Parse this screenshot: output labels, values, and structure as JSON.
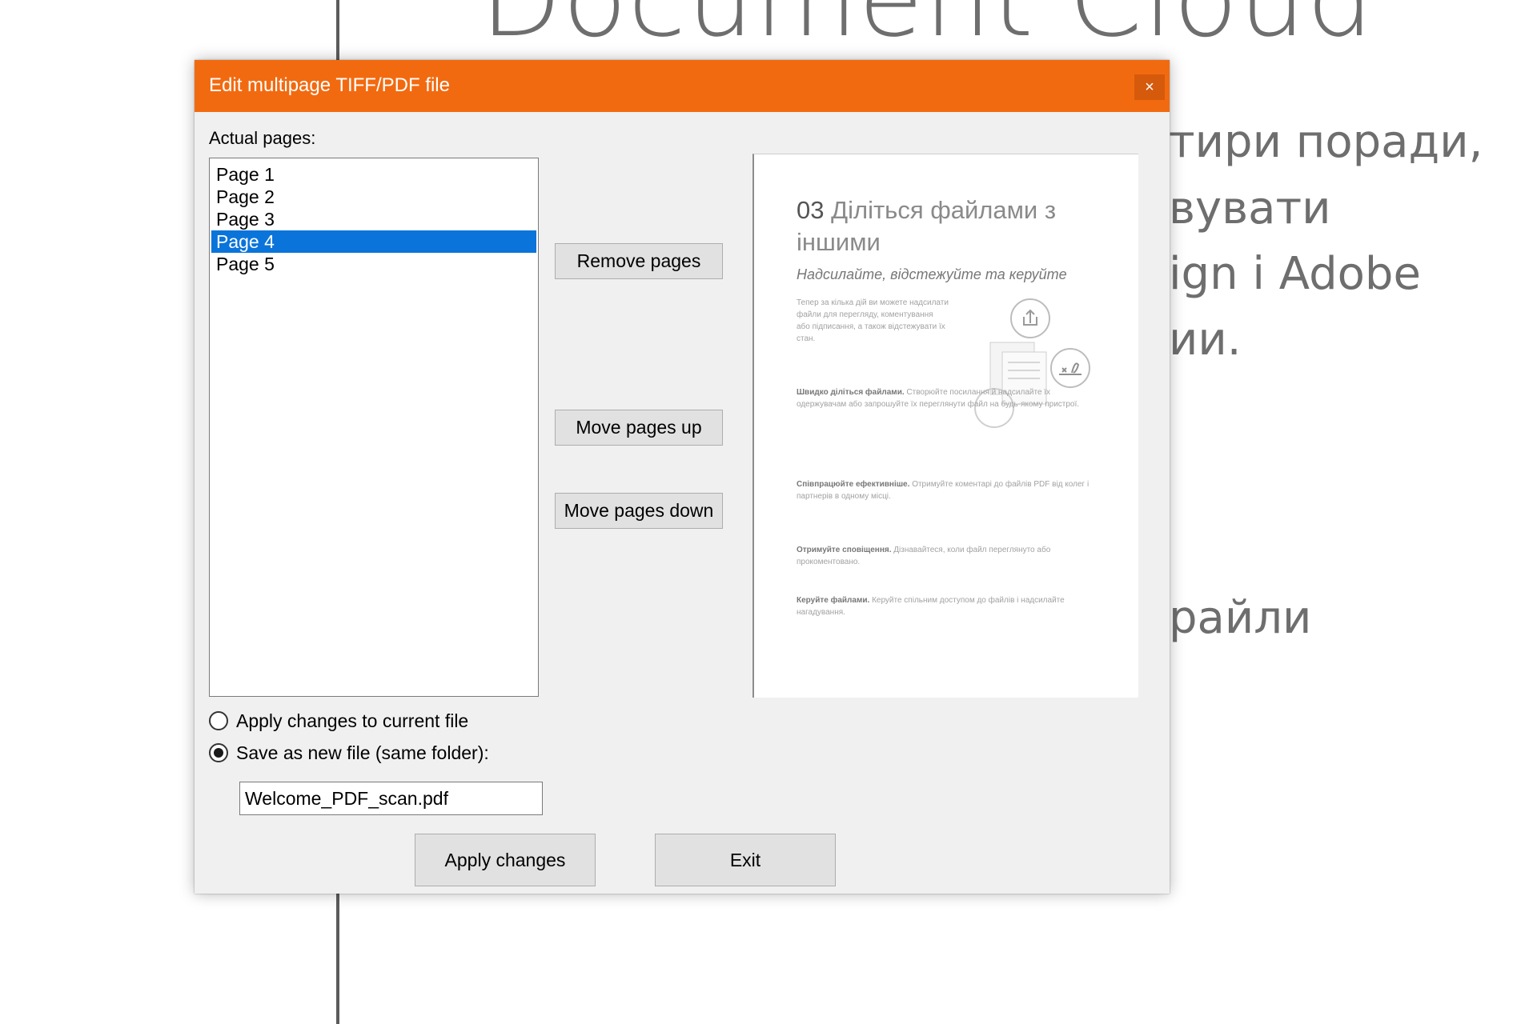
{
  "background": {
    "title": "Document Cloud",
    "lines": [
      "тири поради,",
      "вувати",
      "ign і Adobe",
      "ии.",
      "райли"
    ]
  },
  "dialog": {
    "title": "Edit multipage TIFF/PDF file",
    "close_label": "×",
    "pages_label": "Actual pages:",
    "pages": [
      {
        "label": "Page 1",
        "selected": false
      },
      {
        "label": "Page 2",
        "selected": false
      },
      {
        "label": "Page 3",
        "selected": false
      },
      {
        "label": "Page 4",
        "selected": true
      },
      {
        "label": "Page 5",
        "selected": false
      }
    ],
    "buttons": {
      "remove": "Remove pages",
      "move_up": "Move pages up",
      "move_down": "Move pages down",
      "apply": "Apply changes",
      "exit": "Exit"
    },
    "preview": {
      "number": "03",
      "heading": "Діліться файлами з іншими",
      "subheading": "Надсилайте, відстежуйте та керуйте",
      "intro": "Тепер за кілька дій ви можете надсилати файли для перегляду, коментування або підписання, а також відстежувати їх стан.",
      "p1_title": "Швидко діліться файлами.",
      "p1_text": "Створюйте посилання й надсилайте їх одержувачам або запрошуйте їх переглянути файл на будь-якому пристрої.",
      "p2_title": "Співпрацюйте ефективніше.",
      "p2_text": "Отримуйте коментарі до файлів PDF від колег і партнерів в одному місці.",
      "p3_title": "Отримуйте сповіщення.",
      "p3_text": "Дізнавайтеся, коли файл переглянуто або прокоментовано.",
      "p4_title": "Керуйте файлами.",
      "p4_text": "Керуйте спільним доступом до файлів і надсилайте нагадування."
    },
    "options": {
      "apply_current": "Apply changes to current file",
      "save_new": "Save as new file (same folder):",
      "selected": "save_new",
      "filename": "Welcome_PDF_scan.pdf"
    }
  },
  "icons": {
    "close": "close-icon",
    "share": "share-icon",
    "sign": "sign-icon",
    "document": "document-icon"
  },
  "colors": {
    "titlebar": "#f26a10",
    "selection": "#0a74da",
    "dialog_bg": "#f0f0f0"
  }
}
